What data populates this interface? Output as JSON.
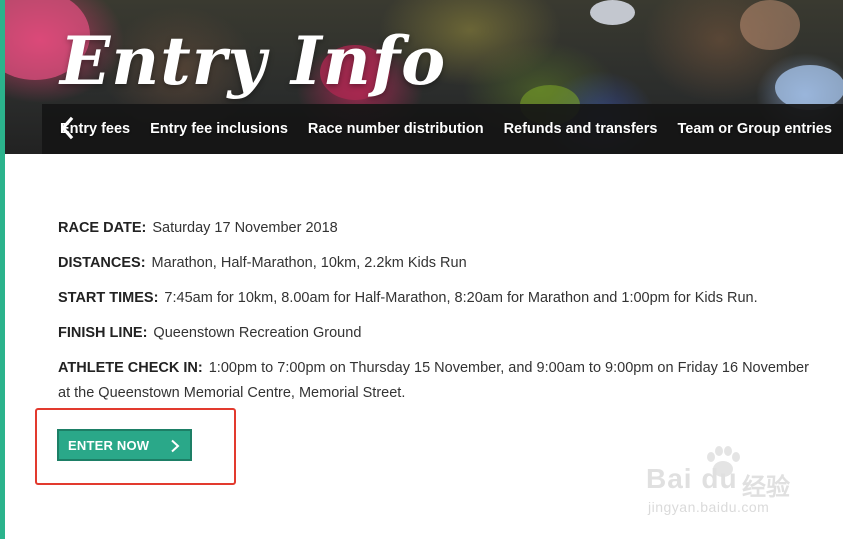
{
  "hero": {
    "title": "Entry Info"
  },
  "nav": {
    "items": [
      "Entry fees",
      "Entry fee inclusions",
      "Race number distribution",
      "Refunds and transfers",
      "Team or Group entries"
    ]
  },
  "details": [
    {
      "label": "RACE DATE:",
      "value": "Saturday 17 November 2018"
    },
    {
      "label": "DISTANCES:",
      "value": "Marathon, Half-Marathon, 10km, 2.2km Kids Run"
    },
    {
      "label": "START TIMES:",
      "value": "7:45am for 10km, 8.00am for Half-Marathon, 8:20am for Marathon and 1:00pm for Kids Run."
    },
    {
      "label": "FINISH LINE:",
      "value": "Queenstown Recreation Ground"
    },
    {
      "label": "ATHLETE CHECK IN:",
      "value": "1:00pm to 7:00pm on Thursday 15 November, and 9:00am to 9:00pm on Friday 16 November at the Queenstown Memorial Centre, Memorial Street."
    }
  ],
  "cta": {
    "label": "ENTER NOW"
  },
  "watermark": {
    "logo": "Bai du",
    "brand": "经验",
    "url": "jingyan.baidu.com"
  },
  "colors": {
    "accent": "#2aa889",
    "accent_border": "#1d7f66",
    "highlight": "#e23a2e",
    "nav_bg": "#161616"
  },
  "icons": {
    "nav_prev": "chevron-left-icon",
    "cta": "chevron-right-icon",
    "watermark": "paw-icon"
  }
}
